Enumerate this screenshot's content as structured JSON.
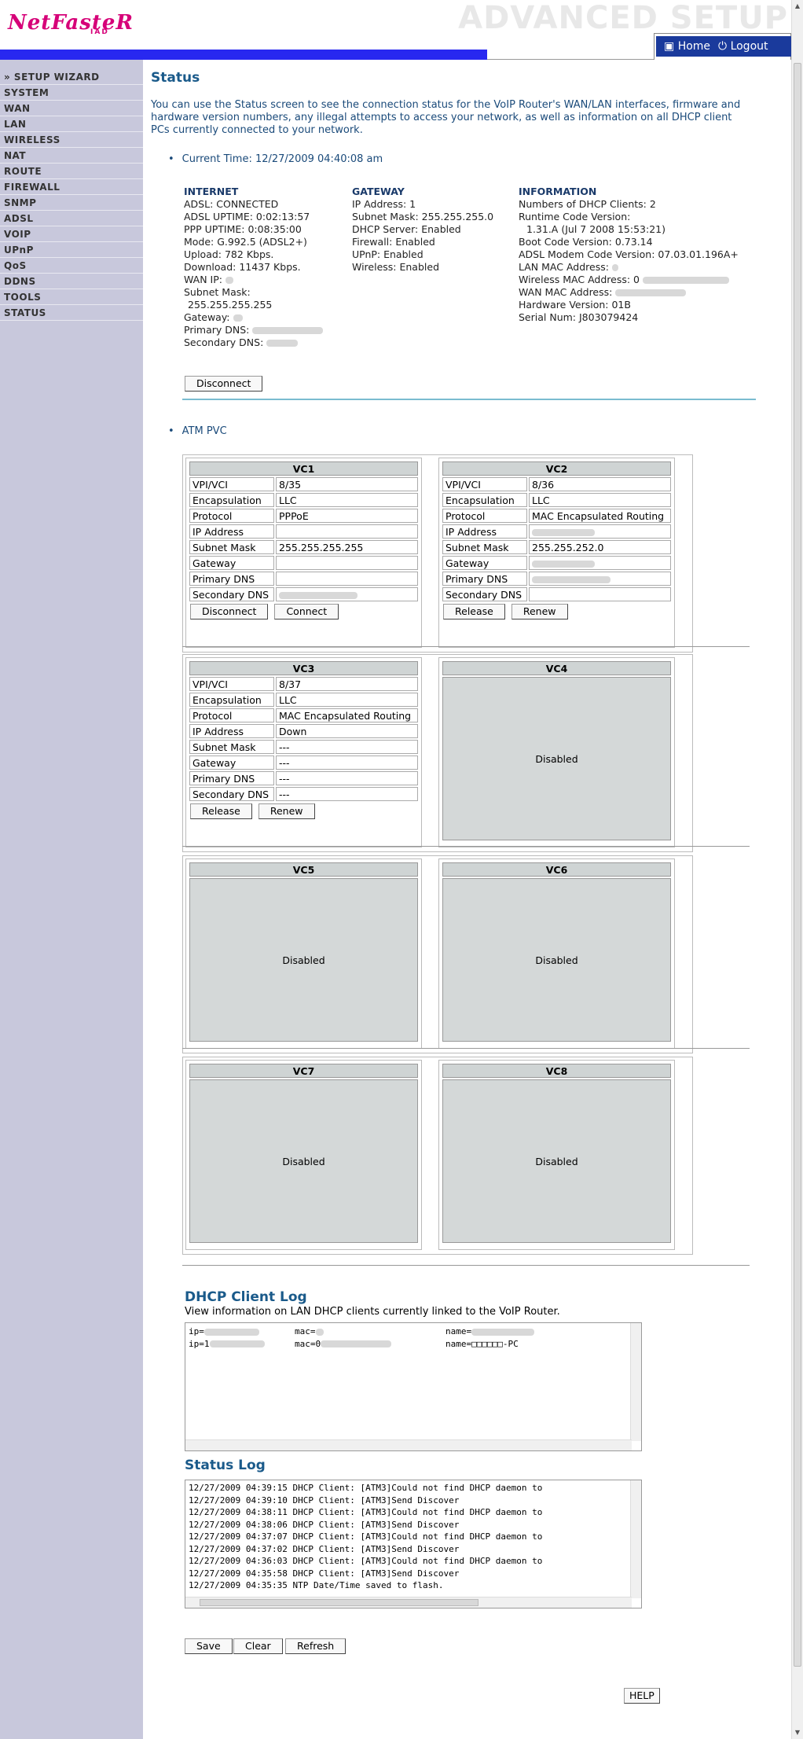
{
  "header": {
    "logo": "NetFasteR",
    "logo_sub": "IAD",
    "section_title": "ADVANCED SETUP",
    "home": "Home",
    "logout": "Logout"
  },
  "sidebar": [
    "» SETUP WIZARD",
    "SYSTEM",
    "WAN",
    "LAN",
    "WIRELESS",
    "NAT",
    "ROUTE",
    "FIREWALL",
    "SNMP",
    "ADSL",
    "VOIP",
    "UPnP",
    "QoS",
    "DDNS",
    "TOOLS",
    "STATUS"
  ],
  "status": {
    "title": "Status",
    "intro": "You can use the Status screen to see the connection status for the VoIP Router's WAN/LAN interfaces, firmware and hardware version numbers, any illegal attempts to access your network, as well as information on all DHCP client PCs currently connected to your network.",
    "current_time": "Current Time: 12/27/2009 04:40:08 am"
  },
  "internet": {
    "title": "INTERNET",
    "lines": [
      "ADSL:  CONNECTED",
      "ADSL UPTIME:  0:02:13:57",
      "PPP UPTIME:  0:08:35:00",
      "Mode:  G.992.5 (ADSL2+)",
      "Upload:  782 Kbps.",
      "Download:  11437 Kbps.",
      "WAN IP:",
      "Subnet Mask:",
      "255.255.255.255",
      "Gateway:",
      "Primary DNS:",
      "Secondary DNS:"
    ]
  },
  "gateway": {
    "title": "GATEWAY",
    "lines": [
      "IP Address:  1",
      "Subnet Mask:  255.255.255.0",
      "DHCP Server:  Enabled",
      "Firewall:  Enabled",
      "UPnP:  Enabled",
      "Wireless:  Enabled"
    ]
  },
  "information": {
    "title": "INFORMATION",
    "lines": [
      "Numbers of DHCP Clients:  2",
      "Runtime Code Version:",
      "1.31.A (Jul 7 2008 15:53:21)",
      "Boot Code Version:  0.73.14",
      "ADSL Modem Code Version:  07.03.01.196A+",
      "LAN MAC Address:",
      "Wireless MAC Address:  0",
      "WAN MAC Address:",
      "Hardware Version:  01B",
      "Serial Num:  J803079424"
    ]
  },
  "disconnect_label": "Disconnect",
  "atm_pvc": "ATM PVC",
  "field_labels": [
    "VPI/VCI",
    "Encapsulation",
    "Protocol",
    "IP Address",
    "Subnet Mask",
    "Gateway",
    "Primary DNS",
    "Secondary DNS"
  ],
  "vcs": {
    "vc1": {
      "title": "VC1",
      "values": [
        "8/35",
        "LLC",
        "PPPoE",
        "",
        "255.255.255.255",
        "",
        "",
        ""
      ],
      "btn1": "Disconnect",
      "btn2": "Connect"
    },
    "vc2": {
      "title": "VC2",
      "values": [
        "8/36",
        "LLC",
        "MAC Encapsulated Routing",
        "",
        "255.255.252.0",
        "",
        "",
        ""
      ],
      "btn1": "Release",
      "btn2": "Renew"
    },
    "vc3": {
      "title": "VC3",
      "values": [
        "8/37",
        "LLC",
        "MAC Encapsulated Routing",
        "Down",
        "---",
        "---",
        "---",
        "---"
      ],
      "btn1": "Release",
      "btn2": "Renew"
    },
    "vc4": {
      "title": "VC4",
      "state": "Disabled"
    },
    "vc5": {
      "title": "VC5",
      "state": "Disabled"
    },
    "vc6": {
      "title": "VC6",
      "state": "Disabled"
    },
    "vc7": {
      "title": "VC7",
      "state": "Disabled"
    },
    "vc8": {
      "title": "VC8",
      "state": "Disabled"
    }
  },
  "dhcp_log": {
    "title": "DHCP Client Log",
    "desc": "View information on LAN DHCP clients currently linked to the VoIP Router.",
    "rows": [
      {
        "ip": "ip=",
        "mac": "mac=",
        "name": "name="
      },
      {
        "ip": "ip=1",
        "mac": "mac=0",
        "name": "name=□□□□□□-PC"
      }
    ]
  },
  "status_log": {
    "title": "Status Log",
    "lines": [
      "12/27/2009  04:39:15 DHCP Client: [ATM3]Could not find DHCP daemon to",
      "12/27/2009  04:39:10 DHCP Client: [ATM3]Send Discover",
      "12/27/2009  04:38:11 DHCP Client: [ATM3]Could not find DHCP daemon to",
      "12/27/2009  04:38:06 DHCP Client: [ATM3]Send Discover",
      "12/27/2009  04:37:07 DHCP Client: [ATM3]Could not find DHCP daemon to",
      "12/27/2009  04:37:02 DHCP Client: [ATM3]Send Discover",
      "12/27/2009  04:36:03 DHCP Client: [ATM3]Could not find DHCP daemon to",
      "12/27/2009  04:35:58 DHCP Client: [ATM3]Send Discover",
      "12/27/2009  04:35:35 NTP Date/Time saved to flash."
    ]
  },
  "buttons": {
    "save": "Save",
    "clear": "Clear",
    "refresh": "Refresh",
    "help": "HELP"
  }
}
